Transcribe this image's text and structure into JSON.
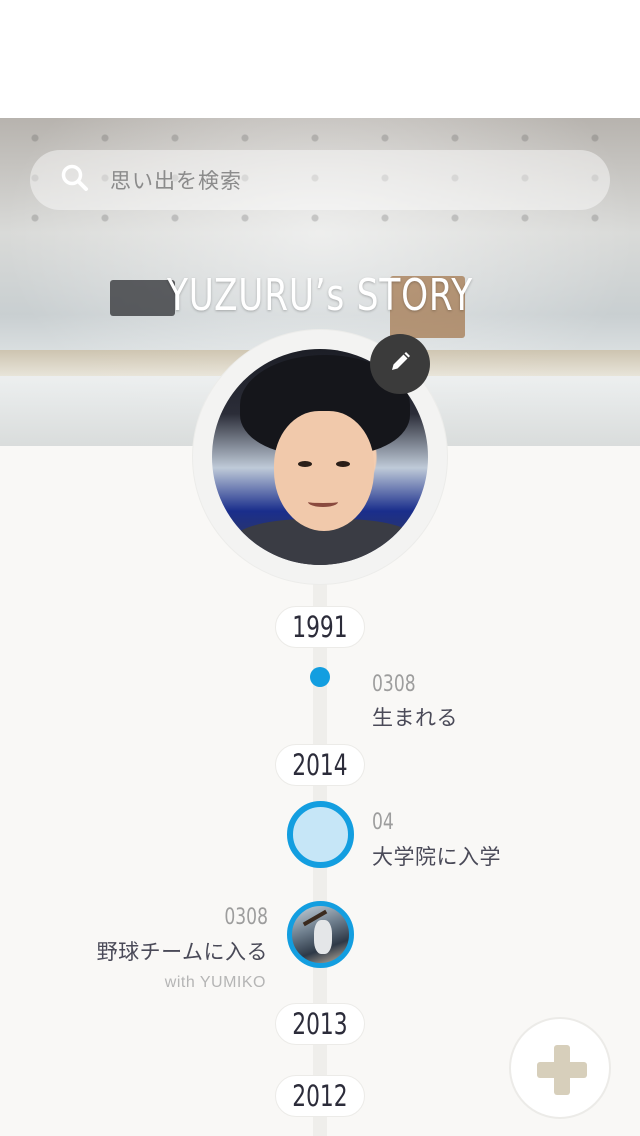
{
  "search": {
    "placeholder": "思い出を検索"
  },
  "header": {
    "title": "YUZURU’s STORY"
  },
  "profile": {
    "avatar_icon": "profile-photo",
    "edit_icon": "pencil-icon"
  },
  "timeline": {
    "years": [
      "1991",
      "2014",
      "2013",
      "2012"
    ],
    "events": [
      {
        "date": "0308",
        "title": "生まれる"
      },
      {
        "date": "04",
        "title": "大学院に入学"
      },
      {
        "date": "0308",
        "title": "野球チームに入る",
        "with": "with YUMIKO"
      }
    ]
  },
  "fab": {
    "icon": "plus-icon"
  },
  "colors": {
    "accent": "#139ee0",
    "accent_light": "#c6e6f7",
    "fab_plus": "#d7cfbb",
    "background": "#f9f8f6"
  }
}
